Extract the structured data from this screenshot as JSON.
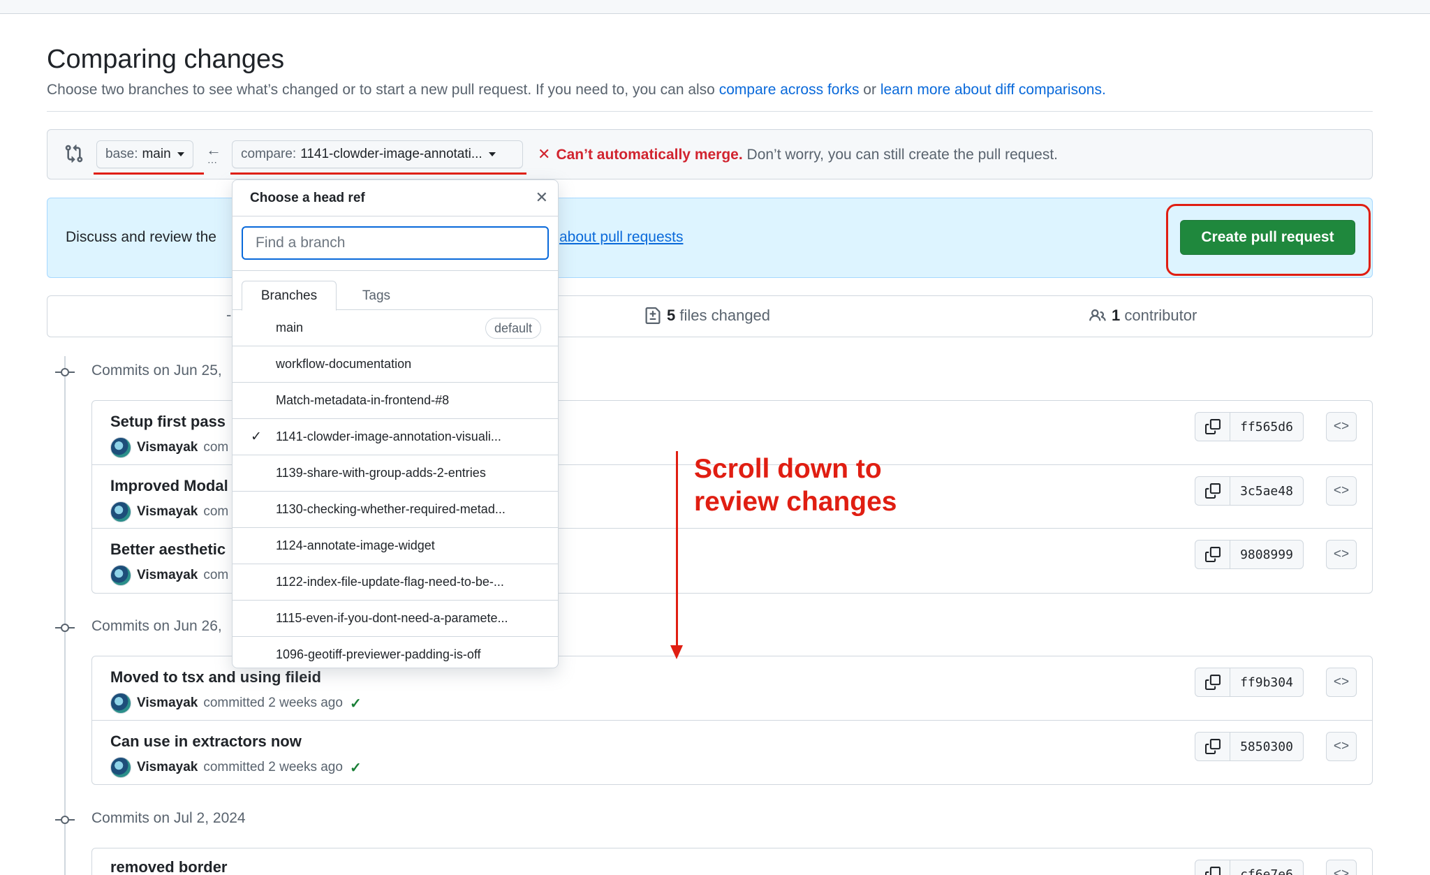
{
  "page": {
    "title": "Comparing changes",
    "subtitle_text": "Choose two branches to see what’s changed or to start a new pull request. If you need to, you can also",
    "subtitle_link1": "compare across forks",
    "subtitle_or": "or",
    "subtitle_link2": "learn more about diff comparisons",
    "subtitle_period": "."
  },
  "range": {
    "base_label": "base:",
    "base_value": "main",
    "compare_label": "compare:",
    "compare_value": "1141-clowder-image-annotati...",
    "merge_error": "Can’t automatically merge.",
    "merge_note": "Don’t worry, you can still create the pull request."
  },
  "banner": {
    "text": "Discuss and review the",
    "link": "about pull requests",
    "create_button": "Create pull request"
  },
  "stats": {
    "files_count": "5",
    "files_label": "files changed",
    "contributors_count": "1",
    "contributors_label": "contributor",
    "dash": "-"
  },
  "dropdown": {
    "title": "Choose a head ref",
    "search_placeholder": "Find a branch",
    "tab_branches": "Branches",
    "tab_tags": "Tags",
    "default_badge": "default",
    "branches": [
      "main",
      "workflow-documentation",
      "Match-metadata-in-frontend-#8",
      "1141-clowder-image-annotation-visuali...",
      "1139-share-with-group-adds-2-entries",
      "1130-checking-whether-required-metad...",
      "1124-annotate-image-widget",
      "1122-index-file-update-flag-need-to-be-...",
      "1115-even-if-you-dont-need-a-paramete...",
      "1096-geotiff-previewer-padding-is-off"
    ],
    "selected_index": 3,
    "default_index": 0
  },
  "groups": [
    {
      "label": "Commits on Jun 25,",
      "commits": [
        {
          "message": "Setup first pass",
          "author": "Vismayak",
          "meta": "com",
          "sha": "ff565d6"
        },
        {
          "message": "Improved Modal",
          "author": "Vismayak",
          "meta": "com",
          "sha": "3c5ae48"
        },
        {
          "message": "Better aesthetic",
          "author": "Vismayak",
          "meta": "com",
          "sha": "9808999"
        }
      ]
    },
    {
      "label": "Commits on Jun 26,",
      "commits": [
        {
          "message": "Moved to tsx and using fileid",
          "author": "Vismayak",
          "meta": "committed 2 weeks ago",
          "sha": "ff9b304"
        },
        {
          "message": "Can use in extractors now",
          "author": "Vismayak",
          "meta": "committed 2 weeks ago",
          "sha": "5850300"
        }
      ]
    },
    {
      "label": "Commits on Jul 2, 2024",
      "commits": [
        {
          "message": "removed border",
          "author": "",
          "meta": "",
          "sha": "cf6e7e6"
        }
      ]
    }
  ],
  "annotation": {
    "line1": "Scroll down to",
    "line2": "review changes",
    "color": "#e01e12"
  },
  "colors": {
    "accent": "#0969da",
    "success": "#1f883d",
    "danger": "#d1242f",
    "banner_bg": "#ddf4ff"
  }
}
